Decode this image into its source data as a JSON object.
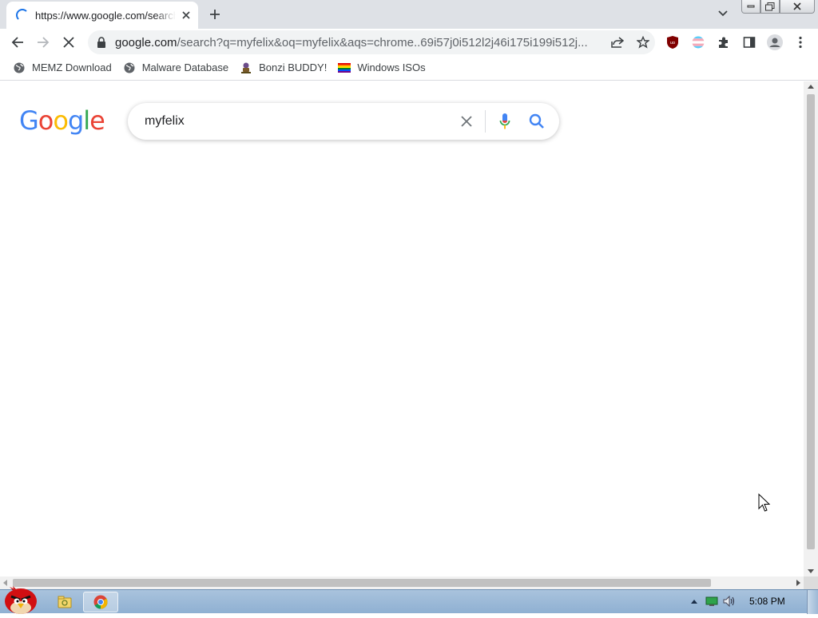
{
  "tab": {
    "title": "https://www.google.com/search?q=myfelix"
  },
  "omnibox": {
    "host": "google.com",
    "path": "/search?q=myfelix&oq=myfelix&aqs=chrome..69i57j0i512l2j46i175i199i512j..."
  },
  "bookmarks": [
    {
      "label": "MEMZ Download",
      "icon": "globe-icon"
    },
    {
      "label": "Malware Database",
      "icon": "globe-icon"
    },
    {
      "label": "Bonzi BUDDY!",
      "icon": "bonzi-icon"
    },
    {
      "label": "Windows ISOs",
      "icon": "rainbow-flag-icon"
    }
  ],
  "search": {
    "query": "myfelix"
  },
  "logo": {
    "letters": [
      "G",
      "o",
      "o",
      "g",
      "l",
      "e"
    ],
    "colors": [
      "#4285F4",
      "#EA4335",
      "#FBBC05",
      "#4285F4",
      "#34A853",
      "#EA4335"
    ]
  },
  "taskbar": {
    "clock": "5:08 PM"
  },
  "colors": {
    "accent": "#1a73e8",
    "tabstrip": "#dee1e6",
    "omnibox": "#f1f3f4"
  }
}
